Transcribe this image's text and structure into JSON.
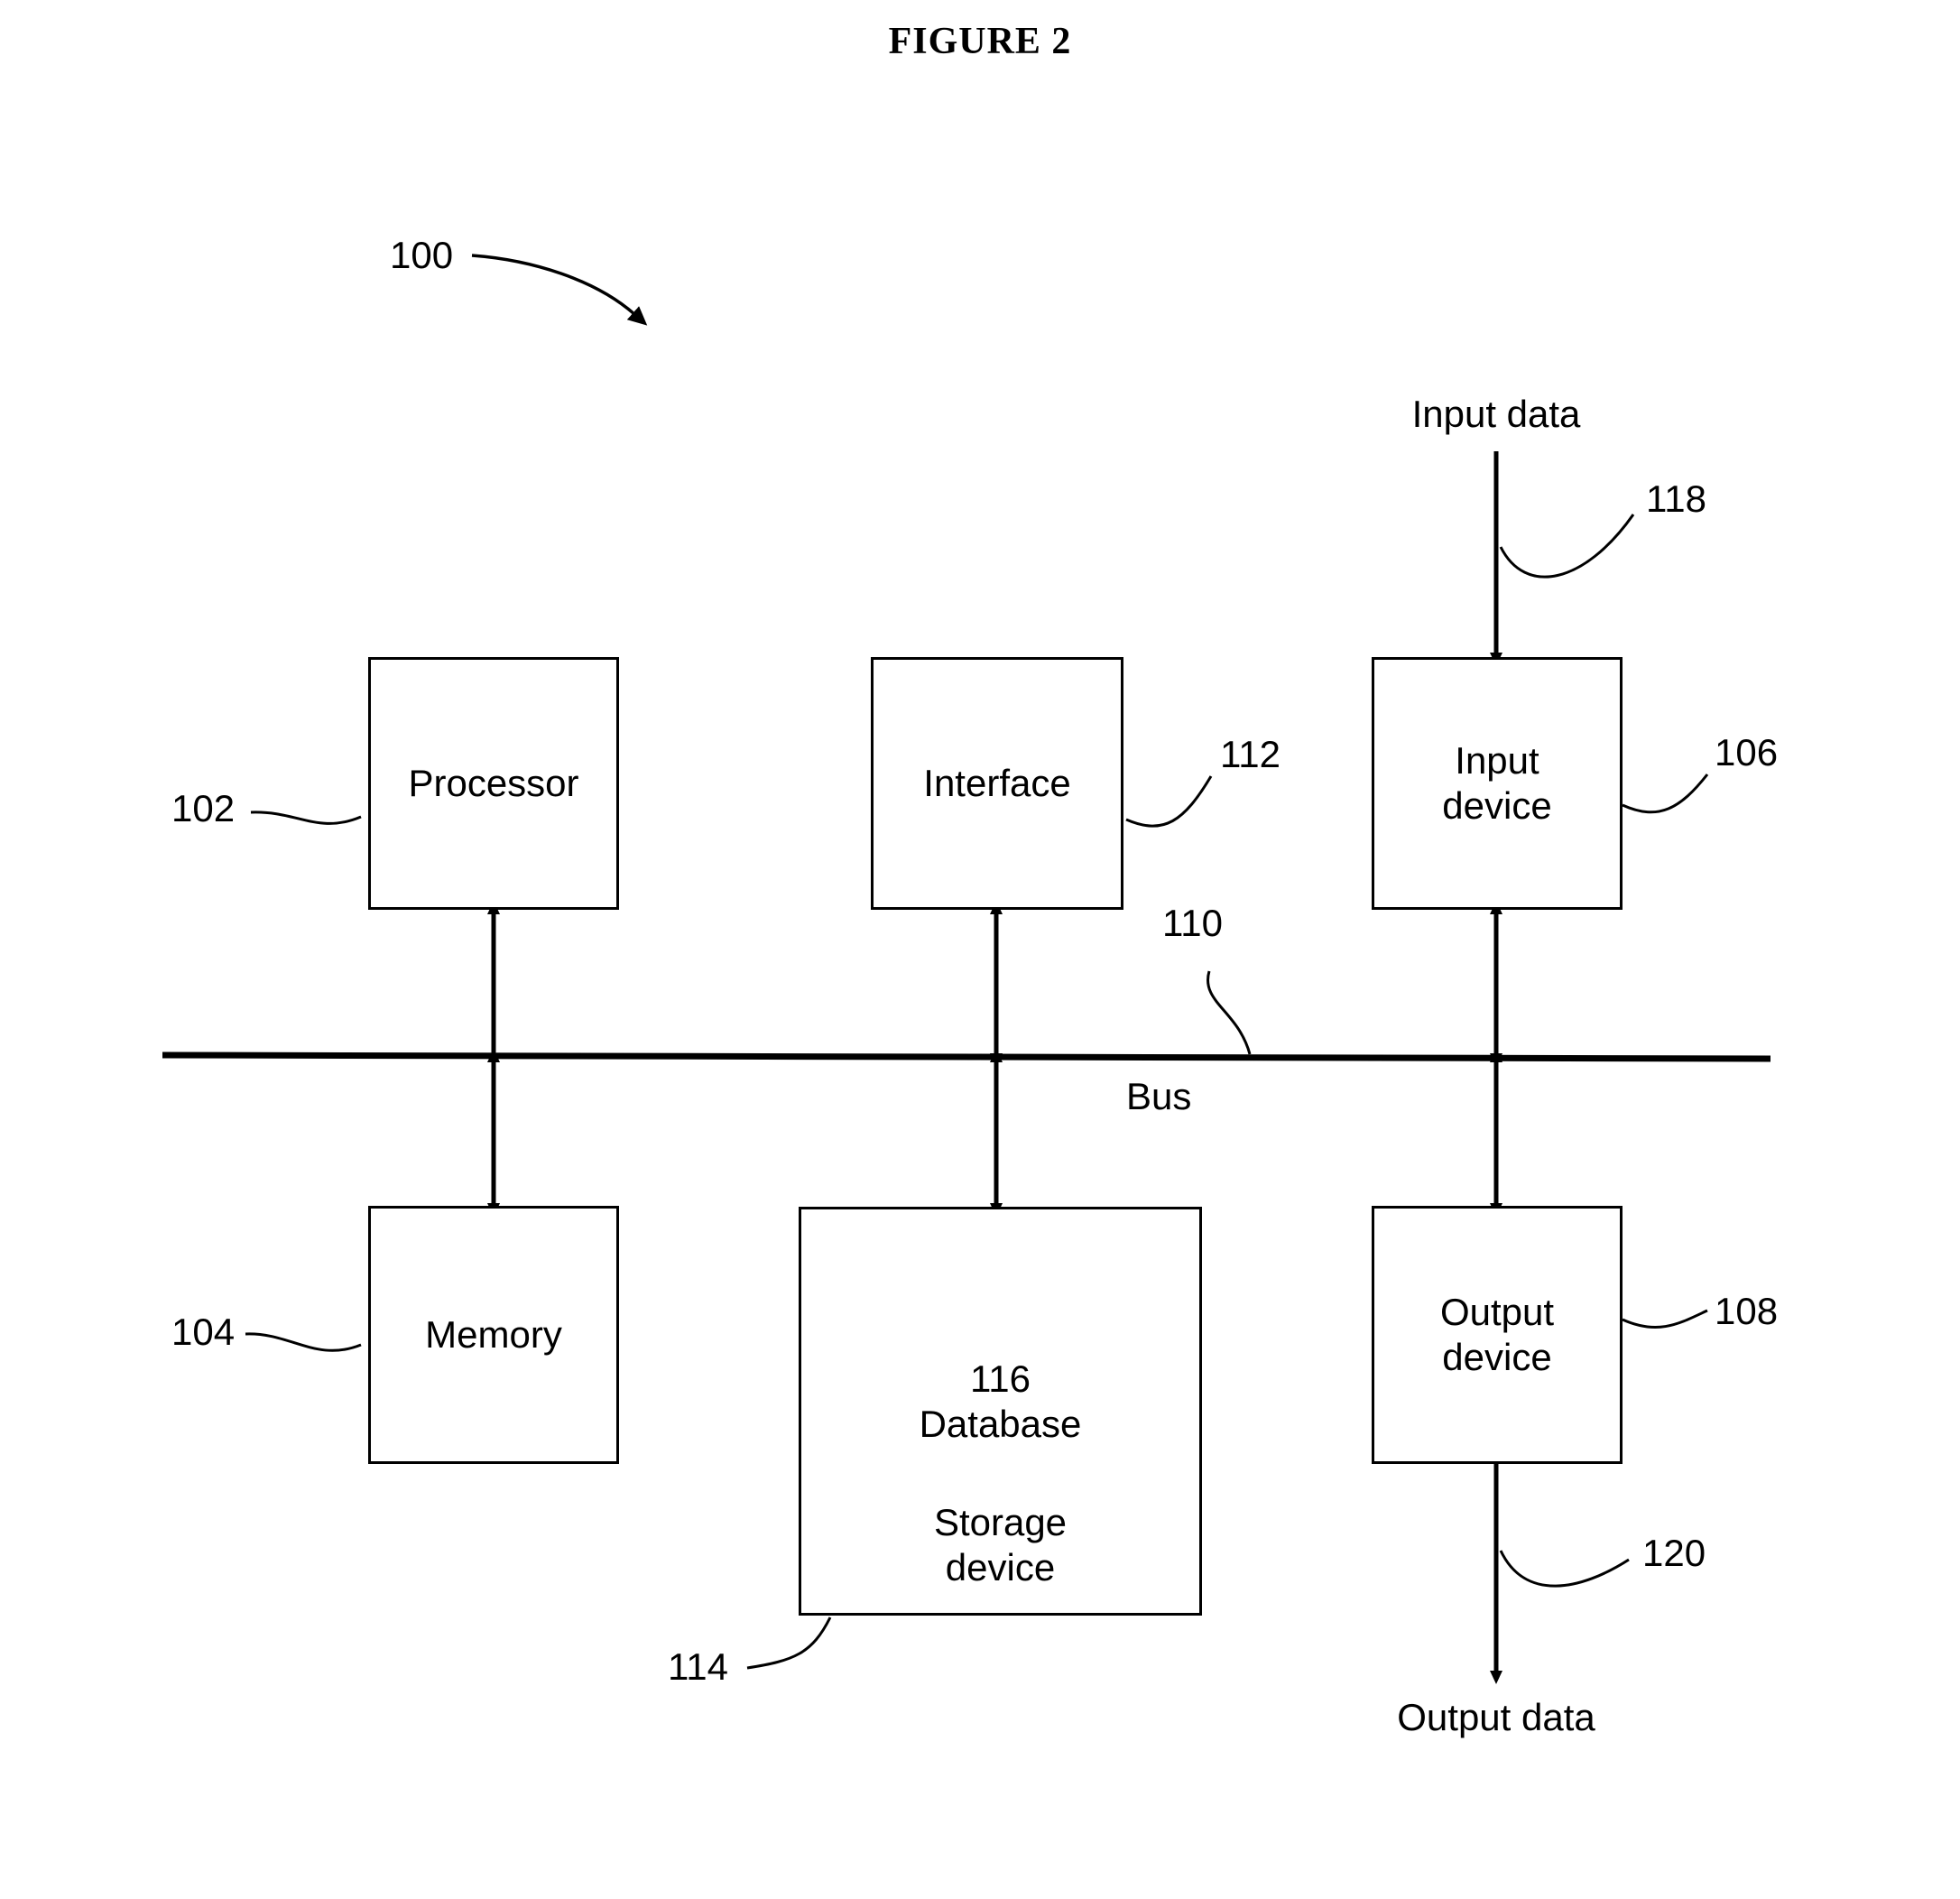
{
  "figure": {
    "title": "FIGURE 2",
    "system_ref": "100"
  },
  "nodes": [
    {
      "id": "processor",
      "label": "Processor",
      "ref": "102"
    },
    {
      "id": "interface",
      "label": "Interface",
      "ref": "112"
    },
    {
      "id": "input-device",
      "label": "Input\ndevice",
      "ref": "106"
    },
    {
      "id": "memory",
      "label": "Memory",
      "ref": "104"
    },
    {
      "id": "storage-device",
      "label": "Storage\ndevice",
      "ref": "114"
    },
    {
      "id": "output-device",
      "label": "Output\ndevice",
      "ref": "108"
    }
  ],
  "bus": {
    "label": "Bus",
    "ref": "110"
  },
  "database": {
    "ref": "116",
    "label": "Database",
    "combined": "116\nDatabase"
  },
  "flows": {
    "input_data_label": "Input data",
    "input_data_ref": "118",
    "output_data_label": "Output data",
    "output_data_ref": "120"
  },
  "colors": {
    "stroke": "#000000",
    "background": "#ffffff"
  }
}
